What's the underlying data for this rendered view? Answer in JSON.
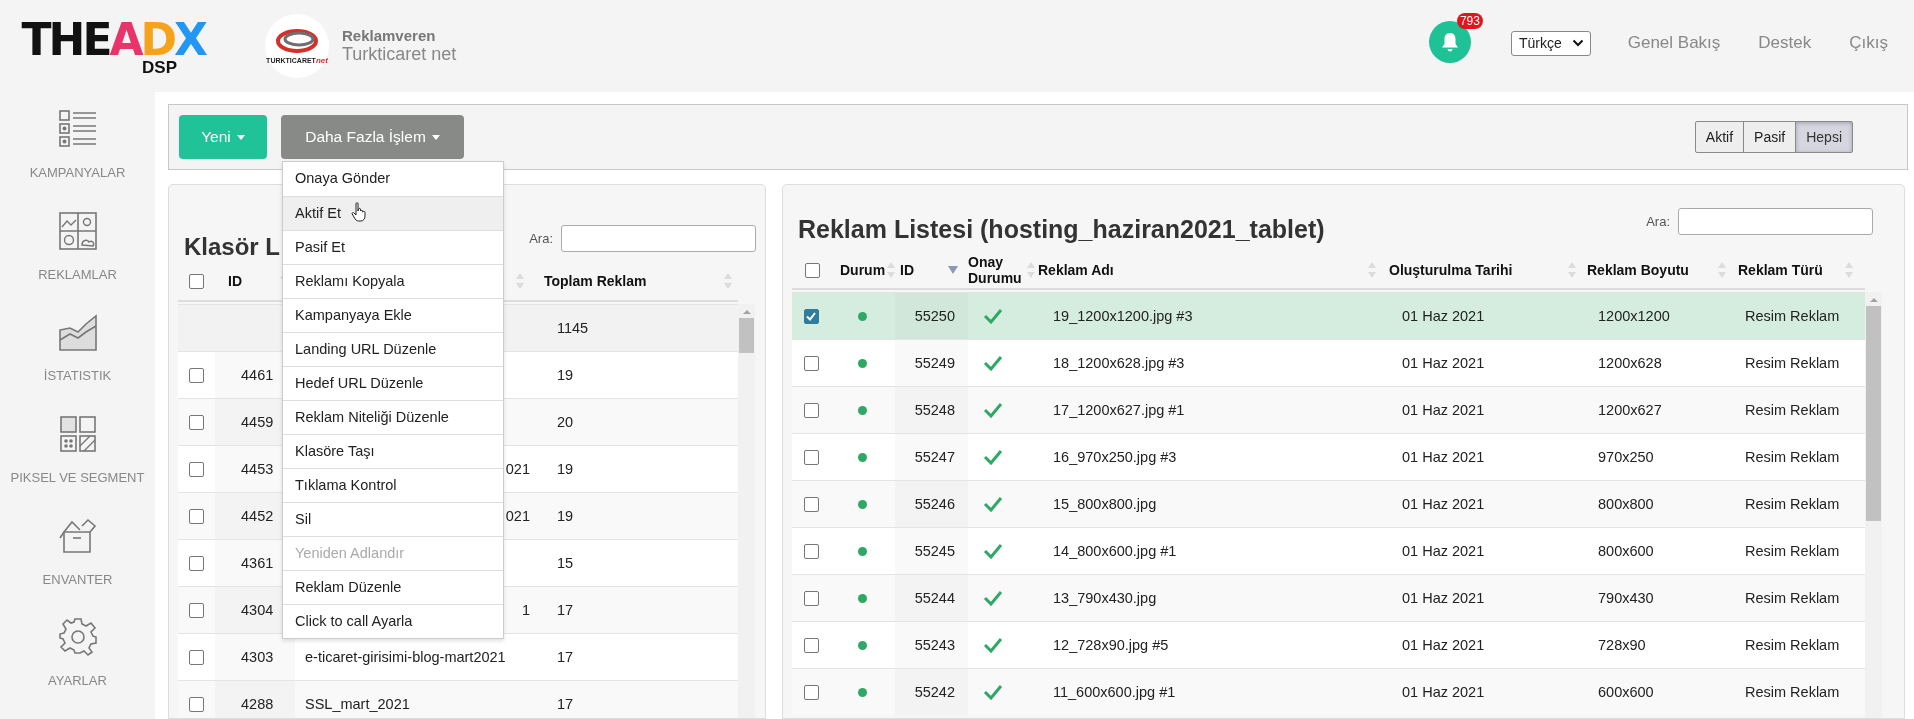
{
  "header": {
    "logo": {
      "parts": [
        {
          "text": "THE",
          "color": "#111111"
        },
        {
          "text": "A",
          "color": "#e8336b"
        },
        {
          "text": "D",
          "color": "#f7a21b"
        },
        {
          "text": "X",
          "color": "#2196f3"
        }
      ],
      "sub": "DSP"
    },
    "advertiser_logo": {
      "text": "TURKTICARET",
      "accent": "net"
    },
    "advertiser": {
      "label": "Reklamveren",
      "name": "Turkticaret net"
    },
    "notifications": {
      "count": "793"
    },
    "language": {
      "value": "Türkçe"
    },
    "nav": [
      "Genel Bakış",
      "Destek",
      "Çıkış"
    ]
  },
  "sidebar": {
    "items": [
      {
        "label": "KAMPANYALAR"
      },
      {
        "label": "REKLAMLAR"
      },
      {
        "label": "İSTATISTIK"
      },
      {
        "label": "PIKSEL VE SEGMENT"
      },
      {
        "label": "ENVANTER"
      },
      {
        "label": "AYARLAR"
      }
    ]
  },
  "toolbar": {
    "buttons": [
      {
        "label": "Yeni",
        "kind": "primary"
      },
      {
        "label": "Daha Fazla İşlem",
        "kind": "secondary"
      }
    ],
    "filter": [
      {
        "label": "Aktif",
        "selected": false
      },
      {
        "label": "Pasif",
        "selected": false
      },
      {
        "label": "Hepsi",
        "selected": true
      }
    ]
  },
  "menu": {
    "items": [
      {
        "label": "Onaya Gönder",
        "hovered": false,
        "disabled": false
      },
      {
        "label": "Aktif Et",
        "hovered": true,
        "disabled": false
      },
      {
        "label": "Pasif Et",
        "hovered": false,
        "disabled": false
      },
      {
        "label": "Reklamı Kopyala",
        "hovered": false,
        "disabled": false
      },
      {
        "label": "Kampanyaya Ekle",
        "hovered": false,
        "disabled": false
      },
      {
        "label": "Landing URL Düzenle",
        "hovered": false,
        "disabled": false
      },
      {
        "label": "Hedef URL Düzenle",
        "hovered": false,
        "disabled": false
      },
      {
        "label": "Reklam Niteliği Düzenle",
        "hovered": false,
        "disabled": false
      },
      {
        "label": "Klasöre Taşı",
        "hovered": false,
        "disabled": false
      },
      {
        "label": "Tıklama Kontrol",
        "hovered": false,
        "disabled": false
      },
      {
        "label": "Sil",
        "hovered": false,
        "disabled": false
      },
      {
        "label": "Yeniden Adlandır",
        "hovered": false,
        "disabled": true
      },
      {
        "label": "Reklam Düzenle",
        "hovered": false,
        "disabled": false
      },
      {
        "label": "Click to call Ayarla",
        "hovered": false,
        "disabled": false
      }
    ]
  },
  "folder_panel": {
    "title": "Klasör L",
    "search_label": "Ara:",
    "select_all": false,
    "columns": [
      {
        "label": "ID",
        "sorted": true
      },
      {
        "sorted": false
      },
      {
        "label": "Toplam Reklam",
        "sorted": false
      }
    ],
    "rows": [
      {
        "kind": "total",
        "total": "1145"
      },
      {
        "kind": "folder",
        "checked": false,
        "id": "4461",
        "total": "19"
      },
      {
        "kind": "folder",
        "checked": false,
        "id": "4459",
        "total": "20"
      },
      {
        "kind": "folder",
        "checked": false,
        "id": "4453",
        "name": "021",
        "cut": true,
        "total": "19"
      },
      {
        "kind": "folder",
        "checked": false,
        "id": "4452",
        "name": "021",
        "cut": true,
        "total": "19"
      },
      {
        "kind": "folder",
        "checked": false,
        "id": "4361",
        "total": "15"
      },
      {
        "kind": "folder",
        "checked": false,
        "id": "4304",
        "name": "1",
        "cut": true,
        "total": "17"
      },
      {
        "kind": "folder",
        "checked": false,
        "id": "4303",
        "name": "e-ticaret-girisimi-blog-mart2021",
        "cut": false,
        "total": "17"
      },
      {
        "kind": "folder",
        "checked": false,
        "id": "4288",
        "name": "SSL_mart_2021",
        "cut": false,
        "total": "17"
      }
    ]
  },
  "ad_panel": {
    "title": "Reklam Listesi (hosting_haziran2021_tablet)",
    "search_label": "Ara:",
    "select_all": false,
    "columns": [
      {
        "label": "Durum",
        "sorted": false
      },
      {
        "label": "ID",
        "sorted": true
      },
      {
        "label": "Onay Durumu",
        "sorted": false
      },
      {
        "label": "Reklam Adı",
        "sorted": false
      },
      {
        "label": "Oluşturulma Tarihi",
        "sorted": false
      },
      {
        "label": "Reklam Boyutu",
        "sorted": false
      },
      {
        "label": "Reklam Türü",
        "sorted": false
      }
    ],
    "rows": [
      {
        "checked": true,
        "active": true,
        "approved": true,
        "id": "55250",
        "name": "19_1200x1200.jpg #3",
        "created": "01 Haz 2021",
        "size": "1200x1200",
        "type": "Resim Reklam"
      },
      {
        "checked": false,
        "active": true,
        "approved": true,
        "id": "55249",
        "name": "18_1200x628.jpg #3",
        "created": "01 Haz 2021",
        "size": "1200x628",
        "type": "Resim Reklam"
      },
      {
        "checked": false,
        "active": true,
        "approved": true,
        "id": "55248",
        "name": "17_1200x627.jpg #1",
        "created": "01 Haz 2021",
        "size": "1200x627",
        "type": "Resim Reklam"
      },
      {
        "checked": false,
        "active": true,
        "approved": true,
        "id": "55247",
        "name": "16_970x250.jpg #3",
        "created": "01 Haz 2021",
        "size": "970x250",
        "type": "Resim Reklam"
      },
      {
        "checked": false,
        "active": true,
        "approved": true,
        "id": "55246",
        "name": "15_800x800.jpg",
        "created": "01 Haz 2021",
        "size": "800x800",
        "type": "Resim Reklam"
      },
      {
        "checked": false,
        "active": true,
        "approved": true,
        "id": "55245",
        "name": "14_800x600.jpg #1",
        "created": "01 Haz 2021",
        "size": "800x600",
        "type": "Resim Reklam"
      },
      {
        "checked": false,
        "active": true,
        "approved": true,
        "id": "55244",
        "name": "13_790x430.jpg",
        "created": "01 Haz 2021",
        "size": "790x430",
        "type": "Resim Reklam"
      },
      {
        "checked": false,
        "active": true,
        "approved": true,
        "id": "55243",
        "name": "12_728x90.jpg #5",
        "created": "01 Haz 2021",
        "size": "728x90",
        "type": "Resim Reklam"
      },
      {
        "checked": false,
        "active": true,
        "approved": true,
        "id": "55242",
        "name": "11_600x600.jpg #1",
        "created": "01 Haz 2021",
        "size": "600x600",
        "type": "Resim Reklam"
      }
    ]
  }
}
